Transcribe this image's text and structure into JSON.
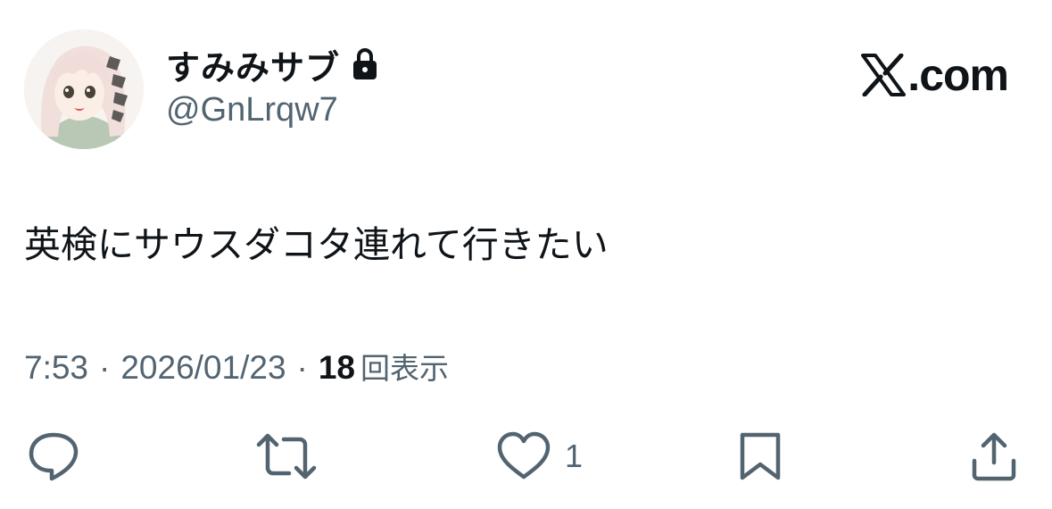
{
  "user": {
    "display_name": "すみみサブ",
    "handle": "@GnLrqw7",
    "protected_icon": "lock-icon",
    "avatar": "anime-girl-avatar"
  },
  "brand": {
    "label": ".com",
    "logo_icon": "x-logo-icon"
  },
  "tweet": {
    "text": "英検にサウスダコタ連れて行きたい"
  },
  "meta": {
    "time": "7:53",
    "separator": "·",
    "date": "2026/01/23",
    "views_count": "18",
    "views_label": "回表示"
  },
  "actions": {
    "reply_icon": "reply-icon",
    "retweet_icon": "retweet-icon",
    "like_icon": "heart-icon",
    "like_count": "1",
    "bookmark_icon": "bookmark-icon",
    "share_icon": "share-icon"
  },
  "colors": {
    "text_primary": "#0f1419",
    "text_secondary": "#536471",
    "background": "#ffffff"
  }
}
